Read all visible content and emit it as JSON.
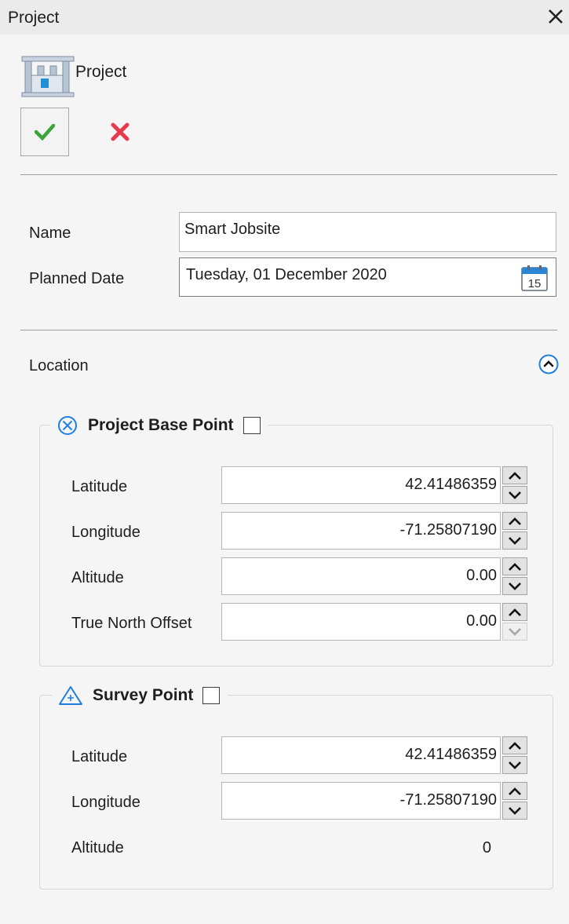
{
  "window": {
    "title": "Project"
  },
  "header": {
    "label": "Project"
  },
  "fields": {
    "name_label": "Name",
    "name_value": "Smart Jobsite",
    "date_label": "Planned Date",
    "date_value": "Tuesday, 01 December 2020",
    "calendar_day": "15"
  },
  "location": {
    "label": "Location",
    "base_point": {
      "title": "Project Base Point",
      "checked": false,
      "rows": [
        {
          "label": "Latitude",
          "value": "42.41486359"
        },
        {
          "label": "Longitude",
          "value": "-71.25807190"
        },
        {
          "label": "Altitude",
          "value": "0.00"
        },
        {
          "label": "True North Offset",
          "value": "0.00"
        }
      ]
    },
    "survey_point": {
      "title": "Survey Point",
      "checked": false,
      "rows": [
        {
          "label": "Latitude",
          "value": "42.41486359"
        },
        {
          "label": "Longitude",
          "value": "-71.25807190"
        },
        {
          "label": "Altitude",
          "value": "0"
        }
      ]
    }
  },
  "colors": {
    "accept": "#3aa53a",
    "cancel": "#e8394a",
    "accent": "#1e7fe0"
  },
  "icons": {
    "close": "close-icon",
    "accept": "checkmark-icon",
    "cancel": "x-icon",
    "calendar": "calendar-icon",
    "collapse": "chevron-up-icon",
    "base_point": "crosshair-circle-icon",
    "survey_point": "triangle-icon"
  }
}
